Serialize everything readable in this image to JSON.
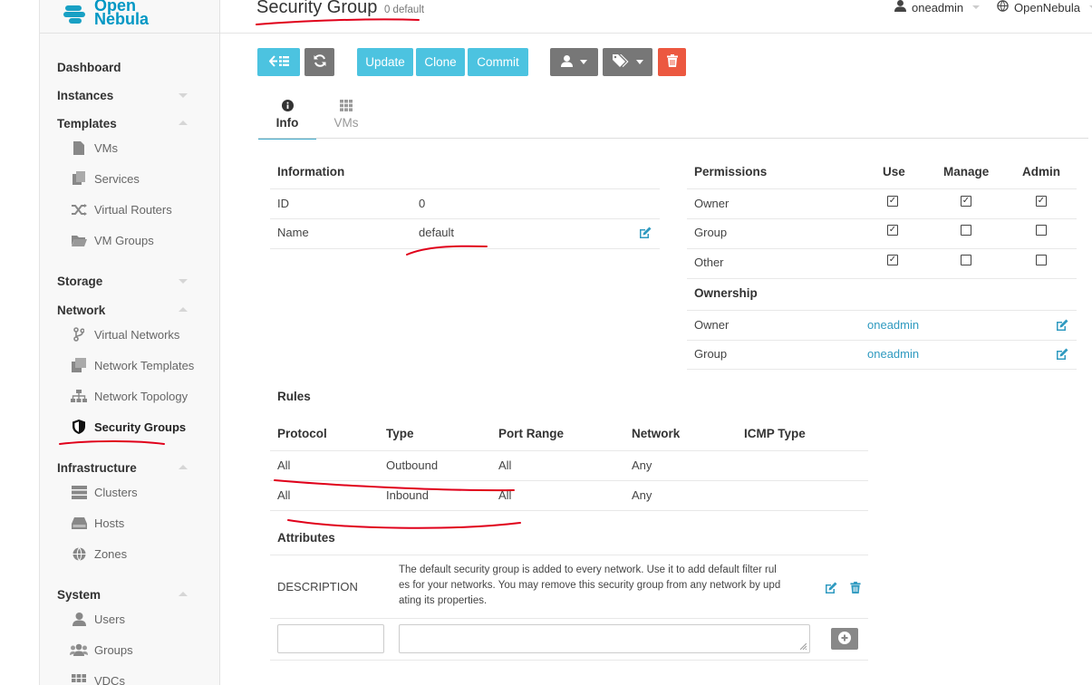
{
  "brand": {
    "line1": "Open",
    "line2": "Nebula"
  },
  "header": {
    "title": "Security Group",
    "subtitle": "0 default",
    "user": "oneadmin",
    "zone": "OpenNebula"
  },
  "sidebar": {
    "dashboard": "Dashboard",
    "instances": "Instances",
    "templates": "Templates",
    "templates_items": [
      "VMs",
      "Services",
      "Virtual Routers",
      "VM Groups"
    ],
    "storage": "Storage",
    "network": "Network",
    "network_items": [
      "Virtual Networks",
      "Network Templates",
      "Network Topology",
      "Security Groups"
    ],
    "infrastructure": "Infrastructure",
    "infrastructure_items": [
      "Clusters",
      "Hosts",
      "Zones"
    ],
    "system": "System",
    "system_items": [
      "Users",
      "Groups",
      "VDCs"
    ]
  },
  "toolbar": {
    "update": "Update",
    "clone": "Clone",
    "commit": "Commit"
  },
  "tabs": {
    "info": "Info",
    "vms": "VMs"
  },
  "information": {
    "title": "Information",
    "rows": [
      {
        "label": "ID",
        "value": "0"
      },
      {
        "label": "Name",
        "value": "default"
      }
    ]
  },
  "permissions": {
    "title": "Permissions",
    "columns": [
      "Use",
      "Manage",
      "Admin"
    ],
    "rows": [
      {
        "label": "Owner",
        "use": true,
        "manage": true,
        "admin": true
      },
      {
        "label": "Group",
        "use": true,
        "manage": false,
        "admin": false
      },
      {
        "label": "Other",
        "use": true,
        "manage": false,
        "admin": false
      }
    ]
  },
  "ownership": {
    "title": "Ownership",
    "rows": [
      {
        "label": "Owner",
        "value": "oneadmin"
      },
      {
        "label": "Group",
        "value": "oneadmin"
      }
    ]
  },
  "rules": {
    "title": "Rules",
    "columns": [
      "Protocol",
      "Type",
      "Port Range",
      "Network",
      "ICMP Type"
    ],
    "rows": [
      [
        "All",
        "Outbound",
        "All",
        "Any",
        ""
      ],
      [
        "All",
        "Inbound",
        "All",
        "Any",
        ""
      ]
    ]
  },
  "attributes": {
    "title": "Attributes",
    "key": "DESCRIPTION",
    "value_lines": [
      "The default security group is added to every network. Use it to add default filter rul",
      "es for your networks. You may remove this security group from any network by upd",
      "ating its properties."
    ]
  },
  "colors": {
    "accent": "#4cc3e0",
    "danger": "#ec5840",
    "link": "#2f9ac0",
    "annotation": "#e0001a"
  }
}
